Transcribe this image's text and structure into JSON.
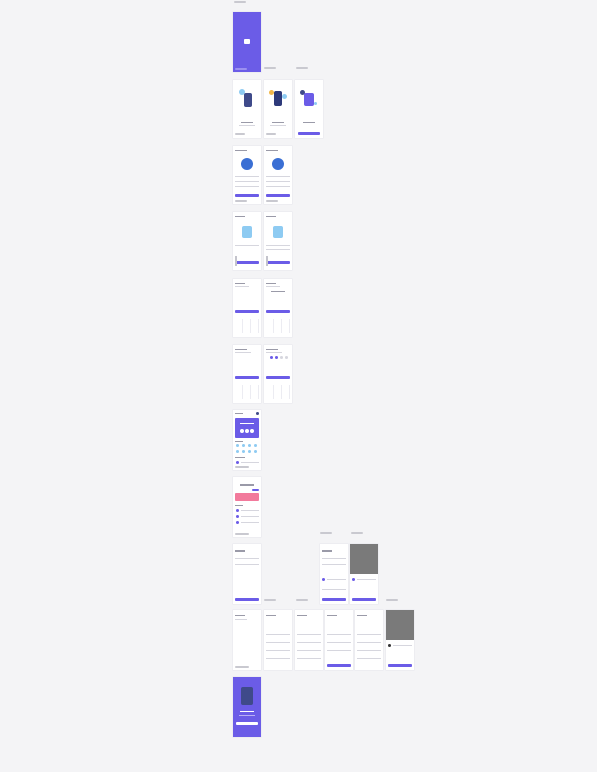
{
  "colors": {
    "accent": "#6b5ce7",
    "background": "#f4f4f6",
    "overlay": "#7a7a7a",
    "pink": "#f27a9c"
  },
  "sections": {
    "splash": {
      "label": "",
      "icon": "wallet-icon"
    },
    "onboarding": {
      "labels": [
        "",
        "",
        ""
      ]
    },
    "home": {
      "greeting": "",
      "wallet_title": ""
    },
    "balance": {
      "amount": "",
      "card_label": ""
    }
  }
}
